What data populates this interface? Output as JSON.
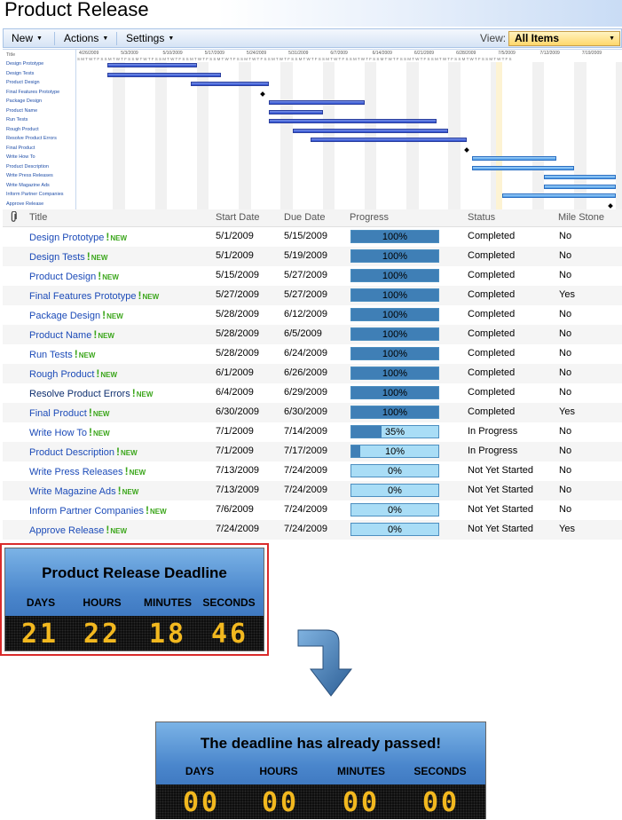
{
  "page": {
    "title": "Product Release"
  },
  "toolbar": {
    "new_label": "New",
    "actions_label": "Actions",
    "settings_label": "Settings",
    "view_label": "View:",
    "view_value": "All Items"
  },
  "gantt": {
    "title_label": "Title",
    "weeks": [
      "4/26/2009",
      "5/3/2009",
      "5/10/2009",
      "5/17/2009",
      "5/24/2009",
      "5/31/2009",
      "6/7/2009",
      "6/14/2009",
      "6/21/2009",
      "6/28/2009",
      "7/5/2009",
      "7/12/2009",
      "7/19/2009"
    ],
    "day_letters": "S M T W T F S S M T W T F S S M T W T F S S M T W T F S S M T W T F S S M T W T F S S M T W T F S S M T W T F S S M T W T F S S M T W T F S S M T W T F S S M T W T F S S M T W T F S S M T W T F S S M T W T F S S M T W T F S"
  },
  "list": {
    "headers": {
      "title": "Title",
      "start": "Start Date",
      "due": "Due Date",
      "progress": "Progress",
      "status": "Status",
      "milestone": "Mile Stone"
    },
    "new_label": "NEW",
    "rows": [
      {
        "title": "Design Prototype",
        "start": "5/1/2009",
        "due": "5/15/2009",
        "progress": 100,
        "progress_label": "100%",
        "status": "Completed",
        "milestone": "No"
      },
      {
        "title": "Design Tests",
        "start": "5/1/2009",
        "due": "5/19/2009",
        "progress": 100,
        "progress_label": "100%",
        "status": "Completed",
        "milestone": "No"
      },
      {
        "title": "Product Design",
        "start": "5/15/2009",
        "due": "5/27/2009",
        "progress": 100,
        "progress_label": "100%",
        "status": "Completed",
        "milestone": "No"
      },
      {
        "title": "Final Features Prototype",
        "start": "5/27/2009",
        "due": "5/27/2009",
        "progress": 100,
        "progress_label": "100%",
        "status": "Completed",
        "milestone": "Yes"
      },
      {
        "title": "Package Design",
        "start": "5/28/2009",
        "due": "6/12/2009",
        "progress": 100,
        "progress_label": "100%",
        "status": "Completed",
        "milestone": "No"
      },
      {
        "title": "Product Name",
        "start": "5/28/2009",
        "due": "6/5/2009",
        "progress": 100,
        "progress_label": "100%",
        "status": "Completed",
        "milestone": "No"
      },
      {
        "title": "Run Tests",
        "start": "5/28/2009",
        "due": "6/24/2009",
        "progress": 100,
        "progress_label": "100%",
        "status": "Completed",
        "milestone": "No"
      },
      {
        "title": "Rough Product",
        "start": "6/1/2009",
        "due": "6/26/2009",
        "progress": 100,
        "progress_label": "100%",
        "status": "Completed",
        "milestone": "No"
      },
      {
        "title": "Resolve Product Errors",
        "start": "6/4/2009",
        "due": "6/29/2009",
        "progress": 100,
        "progress_label": "100%",
        "status": "Completed",
        "milestone": "No"
      },
      {
        "title": "Final Product",
        "start": "6/30/2009",
        "due": "6/30/2009",
        "progress": 100,
        "progress_label": "100%",
        "status": "Completed",
        "milestone": "Yes"
      },
      {
        "title": "Write How To",
        "start": "7/1/2009",
        "due": "7/14/2009",
        "progress": 35,
        "progress_label": "35%",
        "status": "In Progress",
        "milestone": "No"
      },
      {
        "title": "Product Description",
        "start": "7/1/2009",
        "due": "7/17/2009",
        "progress": 10,
        "progress_label": "10%",
        "status": "In Progress",
        "milestone": "No"
      },
      {
        "title": "Write Press Releases",
        "start": "7/13/2009",
        "due": "7/24/2009",
        "progress": 0,
        "progress_label": "0%",
        "status": "Not Yet Started",
        "milestone": "No"
      },
      {
        "title": "Write Magazine Ads",
        "start": "7/13/2009",
        "due": "7/24/2009",
        "progress": 0,
        "progress_label": "0%",
        "status": "Not Yet Started",
        "milestone": "No"
      },
      {
        "title": "Inform Partner Companies",
        "start": "7/6/2009",
        "due": "7/24/2009",
        "progress": 0,
        "progress_label": "0%",
        "status": "Not Yet Started",
        "milestone": "No"
      },
      {
        "title": "Approve Release",
        "start": "7/24/2009",
        "due": "7/24/2009",
        "progress": 0,
        "progress_label": "0%",
        "status": "Not Yet Started",
        "milestone": "Yes"
      }
    ]
  },
  "countdown_active": {
    "title": "Product Release Deadline",
    "units": {
      "days": "DAYS",
      "hours": "HOURS",
      "minutes": "MINUTES",
      "seconds": "SECONDS"
    },
    "values": {
      "days": "21",
      "hours": "22",
      "minutes": "18",
      "seconds": "46"
    }
  },
  "countdown_passed": {
    "title": "The deadline has already passed!",
    "units": {
      "days": "DAYS",
      "hours": "HOURS",
      "minutes": "MINUTES",
      "seconds": "SECONDS"
    },
    "values": {
      "days": "00",
      "hours": "00",
      "minutes": "00",
      "seconds": "00"
    }
  },
  "colors": {
    "completed_fill": "#3f7fb6",
    "bar_track": "#a9ddf6",
    "link": "#1c4bb8",
    "new_badge": "#3ba61b",
    "digits": "#f2b81f",
    "highlight_border": "#d92b2b"
  },
  "icons": {
    "attachment": "paperclip-icon",
    "new": "exclamation-icon",
    "transition": "down-arrow-icon"
  }
}
